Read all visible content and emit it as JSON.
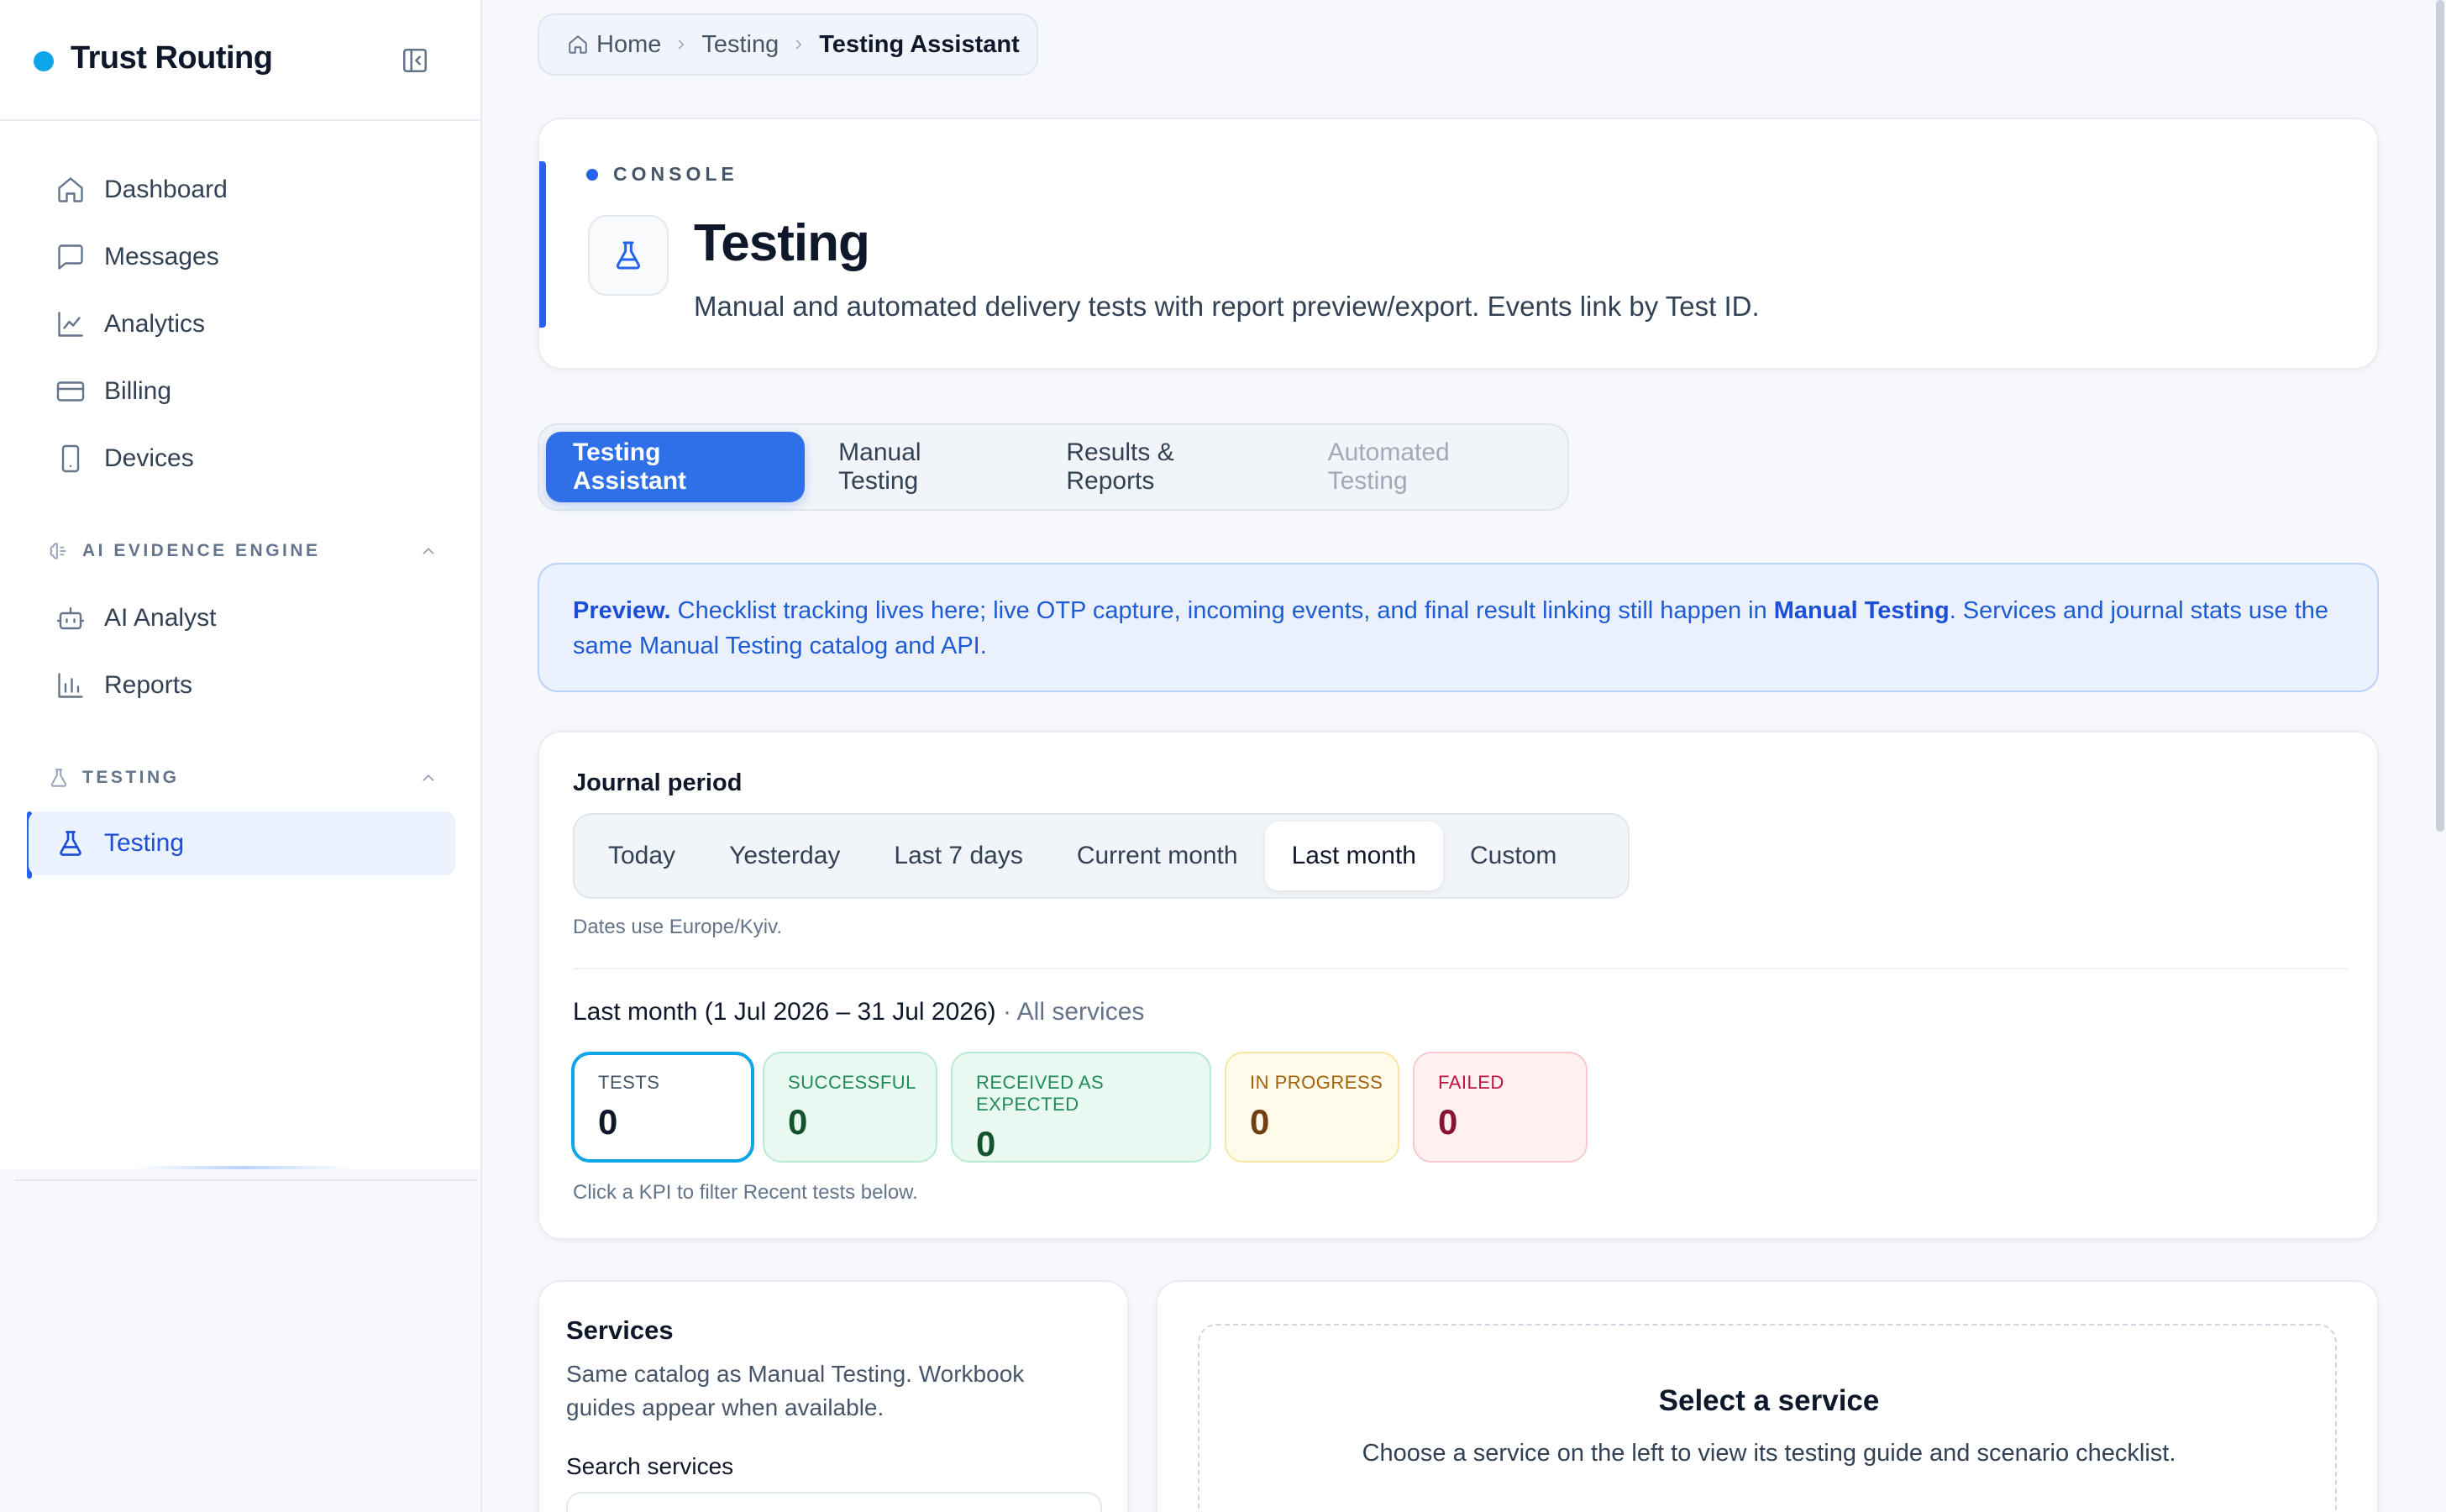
{
  "app": {
    "name": "Trust Routing"
  },
  "sidebar": {
    "items": [
      {
        "label": "Dashboard",
        "icon": "home-icon"
      },
      {
        "label": "Messages",
        "icon": "message-icon"
      },
      {
        "label": "Analytics",
        "icon": "chart-line-icon"
      },
      {
        "label": "Billing",
        "icon": "credit-card-icon"
      },
      {
        "label": "Devices",
        "icon": "smartphone-icon"
      }
    ],
    "groups": [
      {
        "title": "AI EVIDENCE ENGINE",
        "icon": "brain-icon",
        "items": [
          {
            "label": "AI Analyst",
            "icon": "bot-icon"
          },
          {
            "label": "Reports",
            "icon": "bar-chart-icon"
          }
        ]
      },
      {
        "title": "TESTING",
        "icon": "flask-icon",
        "items": [
          {
            "label": "Testing",
            "icon": "flask-icon",
            "active": true
          }
        ]
      }
    ]
  },
  "breadcrumb": {
    "items": [
      "Home",
      "Testing",
      "Testing Assistant"
    ]
  },
  "header": {
    "eyebrow": "CONSOLE",
    "title": "Testing",
    "subtitle": "Manual and automated delivery tests with report preview/export. Events link by Test ID."
  },
  "tabs": [
    {
      "label": "Testing Assistant",
      "state": "active"
    },
    {
      "label": "Manual Testing",
      "state": "normal"
    },
    {
      "label": "Results & Reports",
      "state": "normal"
    },
    {
      "label": "Automated Testing",
      "state": "disabled"
    }
  ],
  "notice": {
    "lead": "Preview.",
    "text1": " Checklist tracking lives here; live OTP capture, incoming events, and final result linking still happen in ",
    "link": "Manual Testing",
    "text2": ". Services and journal stats use the same Manual Testing catalog and API."
  },
  "journal": {
    "label": "Journal period",
    "periods": [
      "Today",
      "Yesterday",
      "Last 7 days",
      "Current month",
      "Last month",
      "Custom"
    ],
    "selected_period": "Last month",
    "tz_note": "Dates use Europe/Kyiv.",
    "range_text": "Last month (1 Jul 2026 – 31 Jul 2026)",
    "scope_text": " · All services",
    "kpis": [
      {
        "label": "TESTS",
        "value": "0"
      },
      {
        "label": "SUCCESSFUL",
        "value": "0"
      },
      {
        "label": "RECEIVED AS EXPECTED",
        "value": "0"
      },
      {
        "label": "IN PROGRESS",
        "value": "0"
      },
      {
        "label": "FAILED",
        "value": "0"
      }
    ],
    "kpi_hint": "Click a KPI to filter Recent tests below."
  },
  "services": {
    "title": "Services",
    "description": "Same catalog as Manual Testing. Workbook guides appear when available.",
    "search_label": "Search services"
  },
  "detail": {
    "title": "Select a service",
    "description": "Choose a service on the left to view its testing guide and scenario checklist."
  },
  "colors": {
    "accent": "#2563eb",
    "brand_dot": "#0ea5e9",
    "success": "#1f8a5b",
    "warning": "#a16207",
    "danger": "#be123c"
  }
}
